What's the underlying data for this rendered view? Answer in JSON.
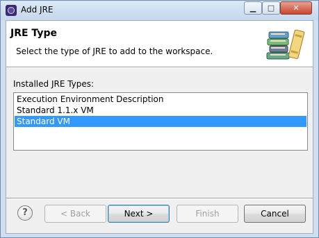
{
  "window": {
    "title": "Add JRE",
    "minimize_glyph": "▁",
    "maximize_glyph": "□",
    "close_glyph": "✕"
  },
  "header": {
    "title": "JRE Type",
    "description": "Select the type of JRE to add to the workspace.",
    "icon": "books-icon"
  },
  "jre_types": {
    "label": "Installed JRE Types:",
    "items": [
      {
        "label": "Execution Environment Description",
        "selected": false
      },
      {
        "label": "Standard 1.1.x VM",
        "selected": false
      },
      {
        "label": "Standard VM",
        "selected": true
      }
    ]
  },
  "footer": {
    "help_glyph": "?",
    "back_label": "< Back",
    "next_label": "Next >",
    "finish_label": "Finish",
    "cancel_label": "Cancel"
  },
  "colors": {
    "selection": "#3399ff",
    "title_bar": "#c6d8ec",
    "close_button": "#c7452e"
  }
}
